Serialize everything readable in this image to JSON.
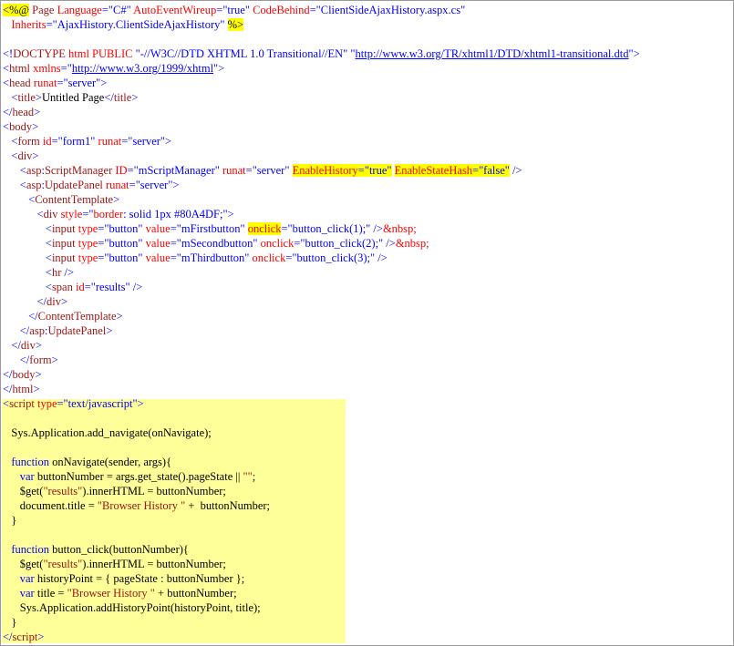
{
  "editor": {
    "lines": [
      [
        {
          "t": "<",
          "c": "b",
          "h": 1
        },
        {
          "t": "%@",
          "c": "k",
          "h": 1
        },
        {
          "t": " Page ",
          "c": "m"
        },
        {
          "t": "Language",
          "c": "r"
        },
        {
          "t": "=\"C#\" ",
          "c": "b"
        },
        {
          "t": "AutoEventWireup",
          "c": "r"
        },
        {
          "t": "=\"true\" ",
          "c": "b"
        },
        {
          "t": "CodeBehind",
          "c": "r"
        },
        {
          "t": "=\"ClientSideAjaxHistory.aspx.cs\"",
          "c": "b"
        }
      ],
      [
        {
          "t": "   Inherits",
          "c": "r"
        },
        {
          "t": "=\"AjaxHistory.ClientSideAjaxHistory\"",
          "c": "b"
        },
        {
          "t": " ",
          "c": "k"
        },
        {
          "t": "%>",
          "c": "k",
          "h": 1
        }
      ],
      [
        {
          "t": "",
          "c": "k"
        }
      ],
      [
        {
          "t": "<!",
          "c": "b"
        },
        {
          "t": "DOCTYPE",
          "c": "m"
        },
        {
          "t": " ",
          "c": "k"
        },
        {
          "t": "html",
          "c": "r"
        },
        {
          "t": " ",
          "c": "k"
        },
        {
          "t": "PUBLIC",
          "c": "r"
        },
        {
          "t": " \"-//W3C//DTD XHTML 1.0 Transitional//EN\" \"",
          "c": "b"
        },
        {
          "t": "http://www.w3.org/TR/xhtml1/DTD/xhtml1-transitional.dtd",
          "c": "u"
        },
        {
          "t": "\">",
          "c": "b"
        }
      ],
      [
        {
          "t": "<",
          "c": "b"
        },
        {
          "t": "html",
          "c": "m"
        },
        {
          "t": " ",
          "c": "k"
        },
        {
          "t": "xmlns",
          "c": "r"
        },
        {
          "t": "=\"",
          "c": "b"
        },
        {
          "t": "http://www.w3.org/1999/xhtml",
          "c": "u"
        },
        {
          "t": "\">",
          "c": "b"
        }
      ],
      [
        {
          "t": "<",
          "c": "b"
        },
        {
          "t": "head",
          "c": "m"
        },
        {
          "t": " ",
          "c": "k"
        },
        {
          "t": "runat",
          "c": "r"
        },
        {
          "t": "=\"server\">",
          "c": "b"
        }
      ],
      [
        {
          "t": "   <",
          "c": "b"
        },
        {
          "t": "title",
          "c": "m"
        },
        {
          "t": ">",
          "c": "b"
        },
        {
          "t": "Untitled Page",
          "c": "k"
        },
        {
          "t": "</",
          "c": "b"
        },
        {
          "t": "title",
          "c": "m"
        },
        {
          "t": ">",
          "c": "b"
        }
      ],
      [
        {
          "t": "</",
          "c": "b"
        },
        {
          "t": "head",
          "c": "m"
        },
        {
          "t": ">",
          "c": "b"
        }
      ],
      [
        {
          "t": "<",
          "c": "b"
        },
        {
          "t": "body",
          "c": "m"
        },
        {
          "t": ">",
          "c": "b"
        }
      ],
      [
        {
          "t": "   <",
          "c": "b"
        },
        {
          "t": "form",
          "c": "m"
        },
        {
          "t": " ",
          "c": "k"
        },
        {
          "t": "id",
          "c": "r"
        },
        {
          "t": "=\"form1\" ",
          "c": "b"
        },
        {
          "t": "runat",
          "c": "r"
        },
        {
          "t": "=\"server\">",
          "c": "b"
        }
      ],
      [
        {
          "t": "   <",
          "c": "b"
        },
        {
          "t": "div",
          "c": "m"
        },
        {
          "t": ">",
          "c": "b"
        }
      ],
      [
        {
          "t": "      <",
          "c": "b"
        },
        {
          "t": "asp",
          "c": "m"
        },
        {
          "t": ":",
          "c": "b"
        },
        {
          "t": "ScriptManager",
          "c": "m"
        },
        {
          "t": " ",
          "c": "k"
        },
        {
          "t": "ID",
          "c": "r"
        },
        {
          "t": "=\"mScriptManager\" ",
          "c": "b"
        },
        {
          "t": "runat",
          "c": "r"
        },
        {
          "t": "=\"server\" ",
          "c": "b"
        },
        {
          "t": "EnableHistory",
          "c": "r",
          "h": 1
        },
        {
          "t": "=\"true\"",
          "c": "b",
          "h": 1
        },
        {
          "t": " ",
          "c": "k"
        },
        {
          "t": "EnableStateHash",
          "c": "r",
          "h": 1
        },
        {
          "t": "=\"false\"",
          "c": "b",
          "h": 1
        },
        {
          "t": " />",
          "c": "b"
        }
      ],
      [
        {
          "t": "      <",
          "c": "b"
        },
        {
          "t": "asp",
          "c": "m"
        },
        {
          "t": ":",
          "c": "b"
        },
        {
          "t": "UpdatePanel",
          "c": "m"
        },
        {
          "t": " ",
          "c": "k"
        },
        {
          "t": "runat",
          "c": "r"
        },
        {
          "t": "=\"server\">",
          "c": "b"
        }
      ],
      [
        {
          "t": "         <",
          "c": "b"
        },
        {
          "t": "ContentTemplate",
          "c": "m"
        },
        {
          "t": ">",
          "c": "b"
        }
      ],
      [
        {
          "t": "            <",
          "c": "b"
        },
        {
          "t": "div",
          "c": "m"
        },
        {
          "t": " ",
          "c": "k"
        },
        {
          "t": "style",
          "c": "r"
        },
        {
          "t": "=\"",
          "c": "b"
        },
        {
          "t": "border",
          "c": "r"
        },
        {
          "t": ": ",
          "c": "b"
        },
        {
          "t": "solid 1px #80A4DF",
          "c": "b"
        },
        {
          "t": ";\">",
          "c": "b"
        }
      ],
      [
        {
          "t": "               <",
          "c": "b"
        },
        {
          "t": "input",
          "c": "m"
        },
        {
          "t": " ",
          "c": "k"
        },
        {
          "t": "type",
          "c": "r"
        },
        {
          "t": "=\"button\" ",
          "c": "b"
        },
        {
          "t": "value",
          "c": "r"
        },
        {
          "t": "=\"mFirstbutton\" ",
          "c": "b"
        },
        {
          "t": "onclick",
          "c": "r",
          "h": 1
        },
        {
          "t": "=\"button_click(1);\"",
          "c": "b"
        },
        {
          "t": " />",
          "c": "b"
        },
        {
          "t": "&nbsp;",
          "c": "r"
        }
      ],
      [
        {
          "t": "               <",
          "c": "b"
        },
        {
          "t": "input",
          "c": "m"
        },
        {
          "t": " ",
          "c": "k"
        },
        {
          "t": "type",
          "c": "r"
        },
        {
          "t": "=\"button\" ",
          "c": "b"
        },
        {
          "t": "value",
          "c": "r"
        },
        {
          "t": "=\"mSecondbutton\" ",
          "c": "b"
        },
        {
          "t": "onclick",
          "c": "r"
        },
        {
          "t": "=\"button_click(2);\"",
          "c": "b"
        },
        {
          "t": " />",
          "c": "b"
        },
        {
          "t": "&nbsp;",
          "c": "r"
        }
      ],
      [
        {
          "t": "               <",
          "c": "b"
        },
        {
          "t": "input",
          "c": "m"
        },
        {
          "t": " ",
          "c": "k"
        },
        {
          "t": "type",
          "c": "r"
        },
        {
          "t": "=\"button\" ",
          "c": "b"
        },
        {
          "t": "value",
          "c": "r"
        },
        {
          "t": "=\"mThirdbutton\" ",
          "c": "b"
        },
        {
          "t": "onclick",
          "c": "r"
        },
        {
          "t": "=\"button_click(3);\"",
          "c": "b"
        },
        {
          "t": " />",
          "c": "b"
        }
      ],
      [
        {
          "t": "               <",
          "c": "b"
        },
        {
          "t": "hr",
          "c": "m"
        },
        {
          "t": " />",
          "c": "b"
        }
      ],
      [
        {
          "t": "               <",
          "c": "b"
        },
        {
          "t": "span",
          "c": "m"
        },
        {
          "t": " ",
          "c": "k"
        },
        {
          "t": "id",
          "c": "r"
        },
        {
          "t": "=\"results\"",
          "c": "b"
        },
        {
          "t": " />",
          "c": "b"
        }
      ],
      [
        {
          "t": "            </",
          "c": "b"
        },
        {
          "t": "div",
          "c": "m"
        },
        {
          "t": ">",
          "c": "b"
        }
      ],
      [
        {
          "t": "         </",
          "c": "b"
        },
        {
          "t": "ContentTemplate",
          "c": "m"
        },
        {
          "t": ">",
          "c": "b"
        }
      ],
      [
        {
          "t": "      </",
          "c": "b"
        },
        {
          "t": "asp",
          "c": "m"
        },
        {
          "t": ":",
          "c": "b"
        },
        {
          "t": "UpdatePanel",
          "c": "m"
        },
        {
          "t": ">",
          "c": "b"
        }
      ],
      [
        {
          "t": "   </",
          "c": "b"
        },
        {
          "t": "div",
          "c": "m"
        },
        {
          "t": ">",
          "c": "b"
        }
      ],
      [
        {
          "t": "      </",
          "c": "b"
        },
        {
          "t": "form",
          "c": "m"
        },
        {
          "t": ">",
          "c": "b"
        }
      ],
      [
        {
          "t": "</",
          "c": "b"
        },
        {
          "t": "body",
          "c": "m"
        },
        {
          "t": ">",
          "c": "b"
        }
      ],
      [
        {
          "t": "</",
          "c": "b"
        },
        {
          "t": "html",
          "c": "m"
        },
        {
          "t": ">",
          "c": "b"
        }
      ],
      [
        {
          "t": "<",
          "c": "b"
        },
        {
          "t": "script",
          "c": "m"
        },
        {
          "t": " ",
          "c": "k"
        },
        {
          "t": "type",
          "c": "r"
        },
        {
          "t": "=\"text/javascript\">",
          "c": "b"
        }
      ],
      [
        {
          "t": "",
          "c": "k"
        }
      ],
      [
        {
          "t": "   Sys.Application.add_navigate(onNavigate);",
          "c": "k"
        }
      ],
      [
        {
          "t": "",
          "c": "k"
        }
      ],
      [
        {
          "t": "   ",
          "c": "k"
        },
        {
          "t": "function",
          "c": "b"
        },
        {
          "t": " onNavigate(sender, args){",
          "c": "k"
        }
      ],
      [
        {
          "t": "      ",
          "c": "k"
        },
        {
          "t": "var",
          "c": "b"
        },
        {
          "t": " buttonNumber = args.get_state().pageState || ",
          "c": "k"
        },
        {
          "t": "\"\"",
          "c": "m"
        },
        {
          "t": ";",
          "c": "k"
        }
      ],
      [
        {
          "t": "      $get(",
          "c": "k"
        },
        {
          "t": "\"results\"",
          "c": "m"
        },
        {
          "t": ").innerHTML = buttonNumber;",
          "c": "k"
        }
      ],
      [
        {
          "t": "      document.title = ",
          "c": "k"
        },
        {
          "t": "\"Browser History \"",
          "c": "m"
        },
        {
          "t": " +  buttonNumber;",
          "c": "k"
        }
      ],
      [
        {
          "t": "   }",
          "c": "k"
        }
      ],
      [
        {
          "t": "",
          "c": "k"
        }
      ],
      [
        {
          "t": "   ",
          "c": "k"
        },
        {
          "t": "function",
          "c": "b"
        },
        {
          "t": " button_click(buttonNumber){",
          "c": "k"
        }
      ],
      [
        {
          "t": "      $get(",
          "c": "k"
        },
        {
          "t": "\"results\"",
          "c": "m"
        },
        {
          "t": ").innerHTML = buttonNumber;",
          "c": "k"
        }
      ],
      [
        {
          "t": "      ",
          "c": "k"
        },
        {
          "t": "var",
          "c": "b"
        },
        {
          "t": " historyPoint = { pageState : buttonNumber };",
          "c": "k"
        }
      ],
      [
        {
          "t": "      ",
          "c": "k"
        },
        {
          "t": "var",
          "c": "b"
        },
        {
          "t": " title = ",
          "c": "k"
        },
        {
          "t": "\"Browser History \"",
          "c": "m"
        },
        {
          "t": " + buttonNumber;",
          "c": "k"
        }
      ],
      [
        {
          "t": "      Sys.Application.addHistoryPoint(historyPoint, title);",
          "c": "k"
        }
      ],
      [
        {
          "t": "   }",
          "c": "k"
        }
      ],
      [
        {
          "t": "</",
          "c": "b"
        },
        {
          "t": "script",
          "c": "m"
        },
        {
          "t": ">",
          "c": "b"
        }
      ]
    ]
  },
  "colors": {
    "delimiter": "#0000ff",
    "element": "#a31515",
    "attribute": "#ff0000",
    "text": "#000000",
    "highlight_inline": "#ffff00",
    "highlight_script_block": "#ffff99",
    "frame_border": "#9a9a9a"
  }
}
